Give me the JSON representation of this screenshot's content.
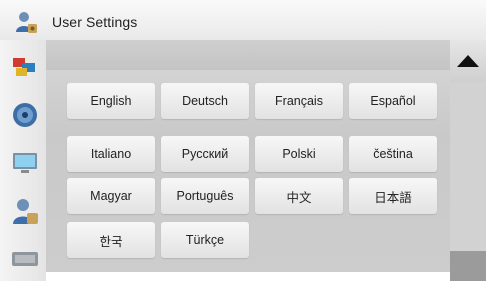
{
  "window": {
    "title": "User Settings",
    "title_icon": "user-settings-icon"
  },
  "rail": {
    "items": [
      {
        "icon": "flags-icon"
      },
      {
        "icon": "disc-icon"
      },
      {
        "icon": "monitor-icon"
      },
      {
        "icon": "user-settings-icon"
      },
      {
        "icon": "keyboard-icon"
      }
    ]
  },
  "languages": [
    "English",
    "Deutsch",
    "Français",
    "Español",
    "Italiano",
    "Русский",
    "Polski",
    "čeština",
    "Magyar",
    "Português",
    "中文",
    "日本語",
    "한국",
    "Türkçe"
  ],
  "scroll": {
    "up_icon": "triangle-up-icon"
  },
  "colors": {
    "panel": "#cccccc",
    "button": "#ededed",
    "thumb": "#9b9b9b"
  }
}
